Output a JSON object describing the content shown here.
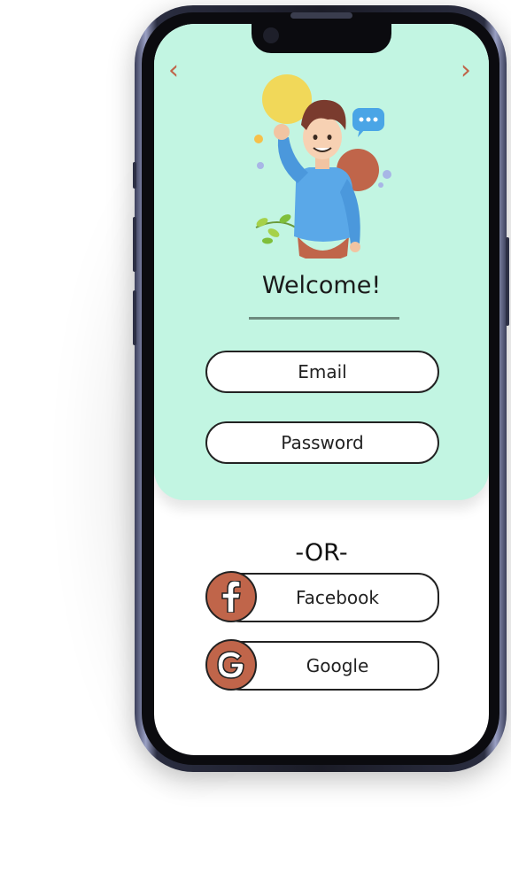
{
  "header": {
    "back_icon": "chevron-left-icon",
    "forward_icon": "chevron-right-icon",
    "back_glyph": "‹",
    "forward_glyph": "›"
  },
  "hero": {
    "illustration": "waving-person-illustration"
  },
  "welcome": {
    "title": "Welcome!"
  },
  "form": {
    "email_placeholder": "Email",
    "password_placeholder": "Password"
  },
  "divider": {
    "text": "-OR-"
  },
  "social": {
    "facebook_label": "Facebook",
    "facebook_icon": "facebook-icon",
    "google_label": "Google",
    "google_icon": "google-icon"
  },
  "colors": {
    "card_background": "#c2f5e2",
    "accent": "#c0654a",
    "text": "#222222"
  }
}
